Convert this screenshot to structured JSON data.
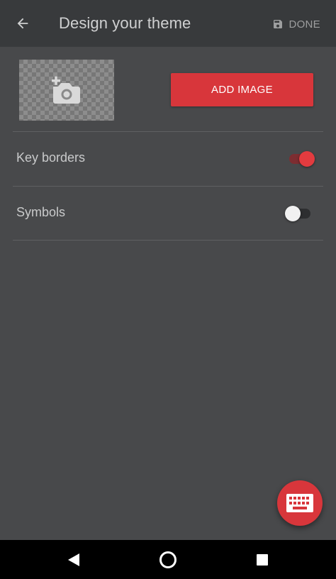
{
  "appbar": {
    "title": "Design your theme",
    "done_label": "DONE",
    "back_icon": "arrow-back-icon",
    "save_icon": "save-icon"
  },
  "image_section": {
    "preview_icon": "add-photo-icon",
    "add_image_label": "ADD IMAGE"
  },
  "settings": [
    {
      "label": "Key borders",
      "enabled": true
    },
    {
      "label": "Symbols",
      "enabled": false
    }
  ],
  "fab": {
    "icon": "keyboard-icon"
  },
  "navbar": {
    "back_icon": "nav-back-icon",
    "home_icon": "nav-home-icon",
    "recents_icon": "nav-recents-icon"
  },
  "colors": {
    "accent": "#d8363b",
    "background": "#48494b",
    "appbar": "#383a3c"
  }
}
